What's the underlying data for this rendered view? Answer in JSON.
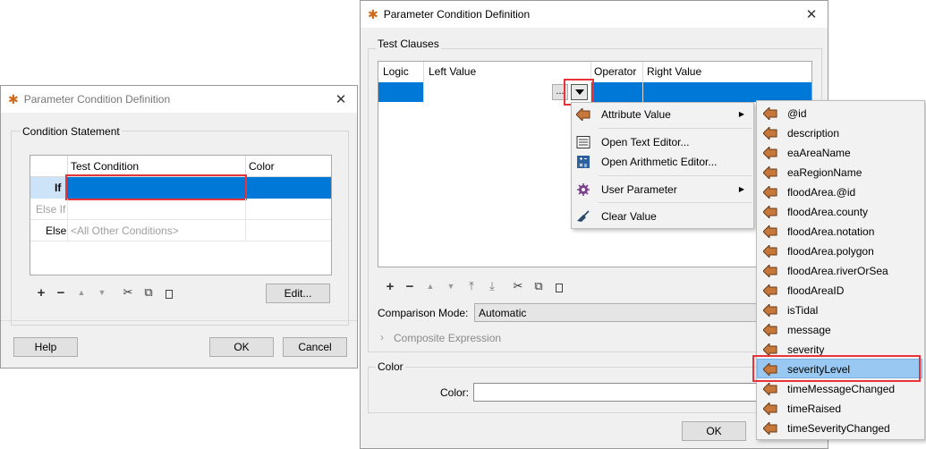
{
  "left_dialog": {
    "title": "Parameter Condition Definition",
    "close": "✕",
    "group_label": "Condition Statement",
    "columns": [
      "Test Condition",
      "Color"
    ],
    "rows": [
      {
        "label": "If",
        "condition": ""
      },
      {
        "label": "Else If",
        "condition": ""
      },
      {
        "label": "Else",
        "condition": "<All Other Conditions>"
      }
    ],
    "edit_button": "Edit...",
    "help_button": "Help",
    "ok_button": "OK",
    "cancel_button": "Cancel"
  },
  "right_dialog": {
    "title": "Parameter Condition Definition",
    "close": "✕",
    "test_clauses_label": "Test Clauses",
    "columns": [
      "Logic",
      "Left Value",
      "Operator",
      "Right Value"
    ],
    "ellipsis": "...",
    "comparison_mode_label": "Comparison Mode:",
    "comparison_mode_value": "Automatic",
    "composite_expression_label": "Composite Expression",
    "color_group_label": "Color",
    "color_field_label": "Color:",
    "color_value": "",
    "ok_button": "OK"
  },
  "toolbar_glyphs": {
    "add": "+",
    "remove": "−",
    "up": "▲",
    "down": "▼",
    "top": "⤒",
    "bottom": "⤓",
    "cut": "✂",
    "copy": "⧉",
    "paste": "📋"
  },
  "context_menu": {
    "items": [
      {
        "label": "Attribute Value",
        "icon": "attribute-arrow-icon",
        "submenu": true
      },
      {
        "label": "Open Text Editor...",
        "icon": "text-editor-icon"
      },
      {
        "label": "Open Arithmetic Editor...",
        "icon": "calculator-icon"
      },
      {
        "label": "User Parameter",
        "icon": "gear-icon",
        "submenu": true
      },
      {
        "label": "Clear Value",
        "icon": "broom-icon"
      }
    ],
    "submenu_arrow": "▶"
  },
  "attribute_submenu": {
    "items": [
      "@id",
      "description",
      "eaAreaName",
      "eaRegionName",
      "floodArea.@id",
      "floodArea.county",
      "floodArea.notation",
      "floodArea.polygon",
      "floodArea.riverOrSea",
      "floodAreaID",
      "isTidal",
      "message",
      "severity",
      "severityLevel",
      "timeMessageChanged",
      "timeRaised",
      "timeSeverityChanged"
    ],
    "selected": "severityLevel"
  },
  "colors": {
    "selection_blue": "#0078d7",
    "highlight_red": "#e6343a",
    "submenu_selected": "#99c9f2",
    "attribute_icon": "#c5773c"
  }
}
